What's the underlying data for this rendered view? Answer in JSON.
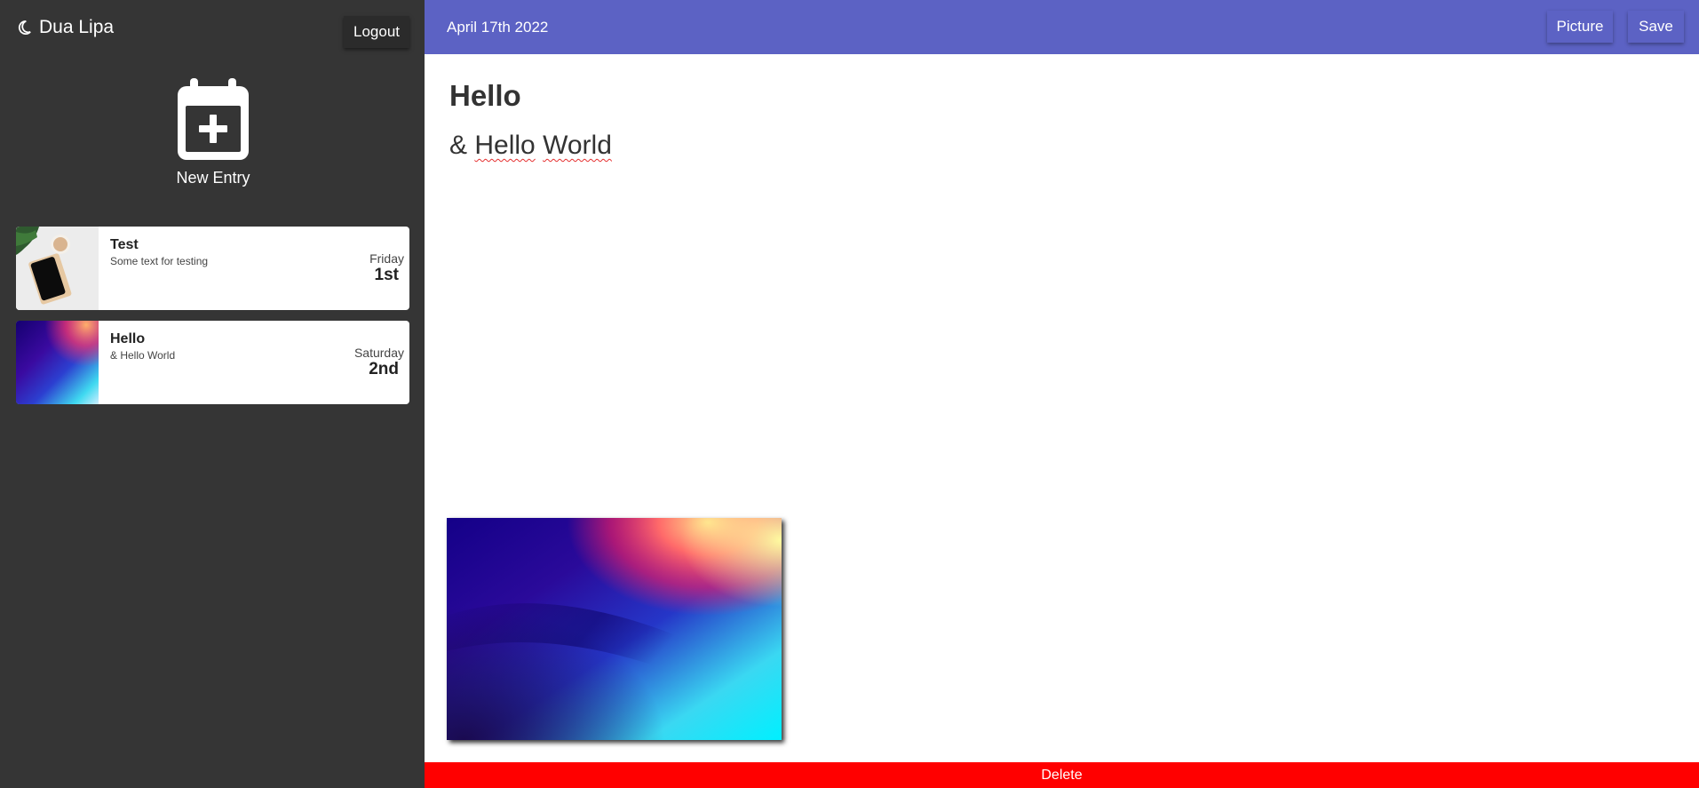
{
  "sidebar": {
    "brand_name": "Dua Lipa",
    "brand_icon": "moon-icon",
    "logout_label": "Logout",
    "new_entry_label": "New Entry",
    "new_entry_icon": "calendar-plus-icon",
    "entries": [
      {
        "title": "Test",
        "text": "Some text for testing",
        "day": "Friday",
        "date": "1st"
      },
      {
        "title": "Hello",
        "text": "& Hello World",
        "day": "Saturday",
        "date": "2nd"
      }
    ]
  },
  "header": {
    "date": "April 17th 2022",
    "picture_label": "Picture",
    "save_label": "Save",
    "accent_color": "#5c62c4"
  },
  "editor": {
    "title": "Hello",
    "body_prefix": "&",
    "body_word1": "Hello",
    "body_word2": "World"
  },
  "footer": {
    "delete_label": "Delete",
    "delete_color": "#ff0000"
  }
}
